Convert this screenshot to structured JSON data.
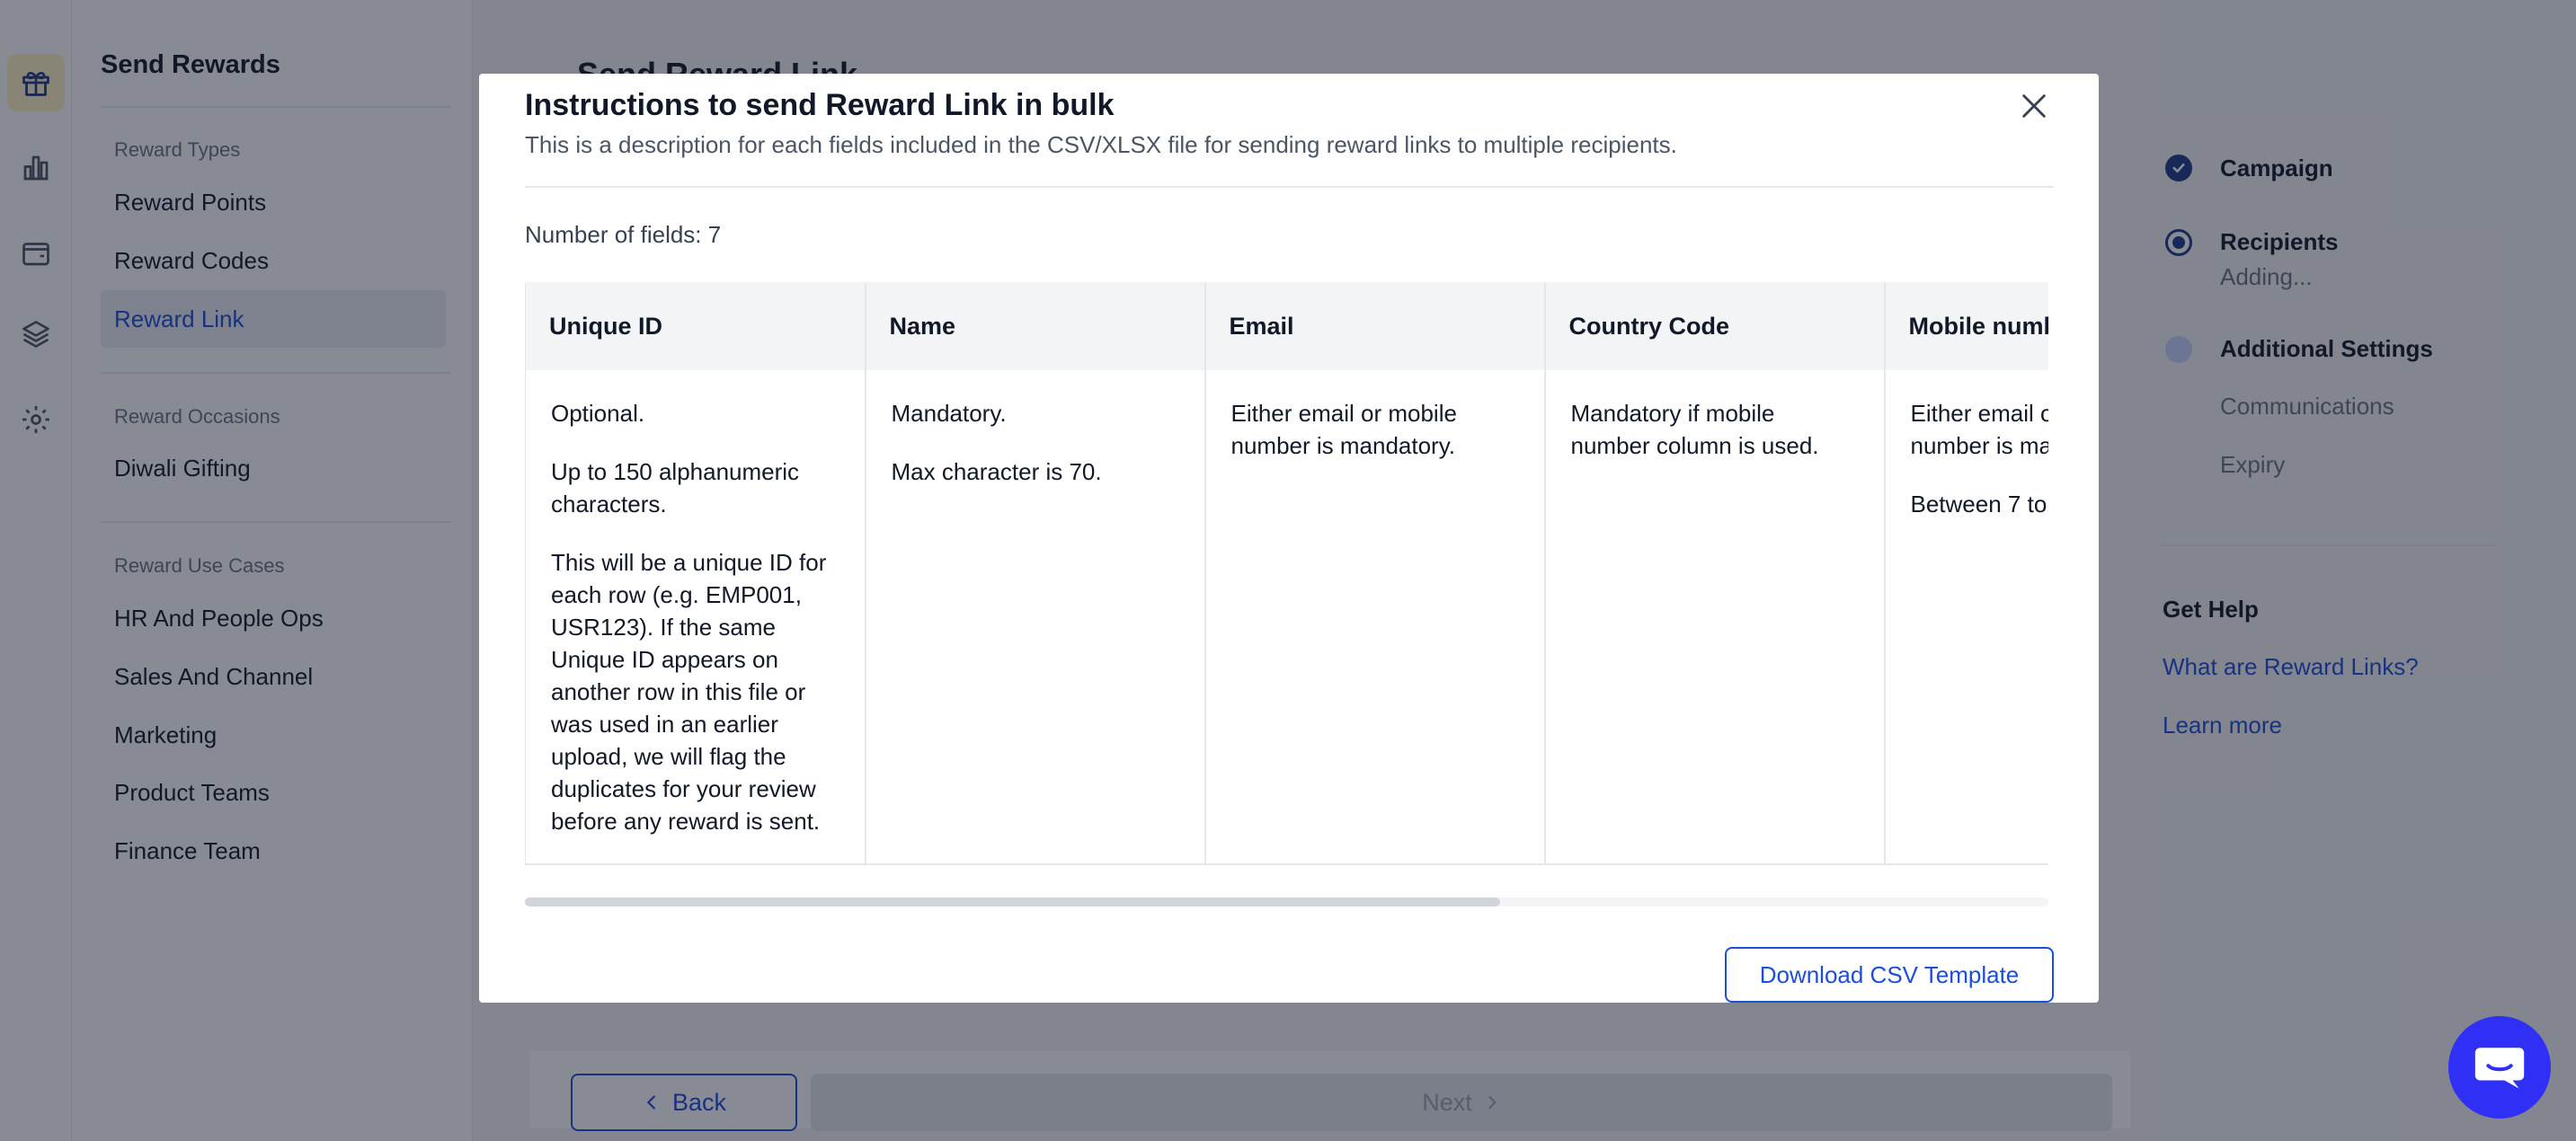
{
  "app": {
    "rail_icons": [
      "gift-icon",
      "bar-chart-icon",
      "wallet-icon",
      "layers-icon",
      "gear-icon"
    ],
    "accent_color": "#1d4ed8"
  },
  "sidebar": {
    "title": "Send Rewards",
    "groups": [
      {
        "label": "Reward Types",
        "items": [
          "Reward Points",
          "Reward Codes",
          "Reward Link"
        ]
      },
      {
        "label": "Reward Occasions",
        "items": [
          "Diwali Gifting"
        ]
      },
      {
        "label": "Reward Use Cases",
        "items": [
          "HR And People Ops",
          "Sales And Channel",
          "Marketing",
          "Product Teams",
          "Finance Team"
        ]
      }
    ],
    "active_item": "Reward Link"
  },
  "main": {
    "title": "Send Reward Link"
  },
  "stepper": {
    "steps": [
      {
        "label": "Campaign",
        "status": "done"
      },
      {
        "label": "Recipients",
        "sub": "Adding...",
        "status": "current"
      },
      {
        "label": "Additional Settings",
        "status": "pending",
        "subs": [
          "Communications",
          "Expiry"
        ]
      }
    ],
    "help_title": "Get Help",
    "help_links": [
      "What are Reward Links?",
      "Learn more"
    ]
  },
  "footer": {
    "back_label": "Back",
    "next_label": "Next"
  },
  "modal": {
    "title": "Instructions to send Reward Link in bulk",
    "description": "This is a description for each fields included in the CSV/XLSX file for sending reward links to multiple recipients.",
    "field_count": "Number of fields: 7",
    "columns": [
      "Unique ID",
      "Name",
      "Email",
      "Country Code",
      "Mobile number"
    ],
    "cells": [
      [
        "Optional.",
        "Up to 150 alphanumeric characters.",
        "This will be a unique ID for each row (e.g. EMP001, USR123). If the same Unique ID appears on another row in this file or was used in an earlier upload, we will flag the duplicates for your review before any reward is sent."
      ],
      [
        "Mandatory.",
        "Max character is 70."
      ],
      [
        "Either email or mobile number is mandatory."
      ],
      [
        "Mandatory if mobile number column is used."
      ],
      [
        "Either email or mobile number is mandatory.",
        "Between 7 to"
      ]
    ],
    "download_label": "Download CSV Template",
    "scroll_progress": 0.64
  }
}
